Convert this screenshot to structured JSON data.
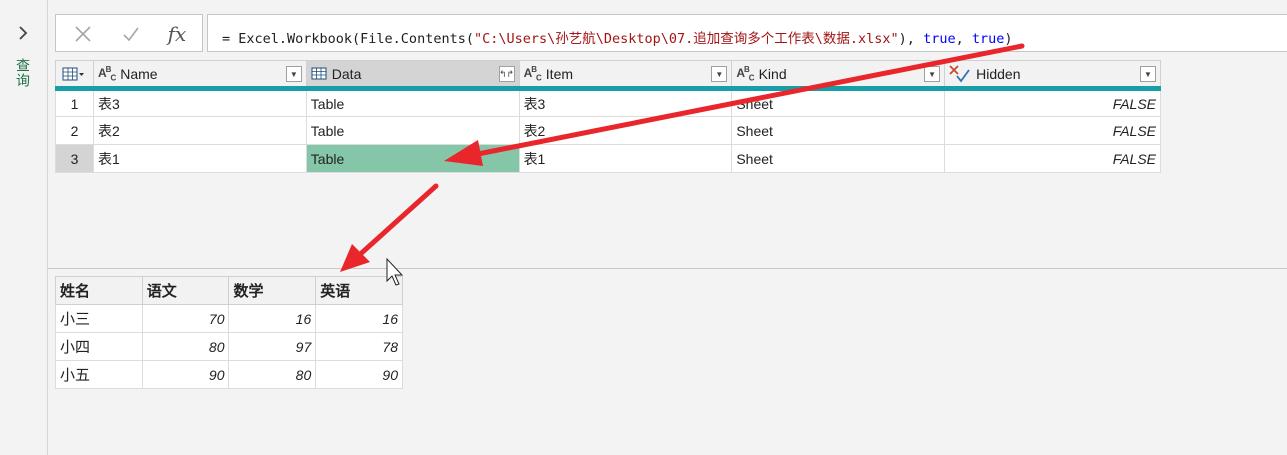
{
  "formula": {
    "prefix": "= Excel.Workbook(File.Contents(",
    "path": "\"C:\\Users\\孙艺航\\Desktop\\07.追加查询多个工作表\\数据.xlsx\"",
    "comma1": "), ",
    "arg1": "true",
    "comma2": ", ",
    "arg2": "true",
    "suffix": ")",
    "cancel_icon": "close-icon",
    "confirm_icon": "check-icon",
    "fx_label": "fx"
  },
  "queries_pane": {
    "label": "查询"
  },
  "main_table": {
    "columns": [
      {
        "type": "ABC",
        "label": "Name"
      },
      {
        "type": "table",
        "label": "Data"
      },
      {
        "type": "ABC",
        "label": "Item"
      },
      {
        "type": "ABC",
        "label": "Kind"
      },
      {
        "type": "logical",
        "label": "Hidden"
      }
    ],
    "rows": [
      {
        "num": "1",
        "name": "表3",
        "data": "Table",
        "item": "表3",
        "kind": "Sheet",
        "hidden": "FALSE"
      },
      {
        "num": "2",
        "name": "表2",
        "data": "Table",
        "item": "表2",
        "kind": "Sheet",
        "hidden": "FALSE"
      },
      {
        "num": "3",
        "name": "表1",
        "data": "Table",
        "item": "表1",
        "kind": "Sheet",
        "hidden": "FALSE"
      }
    ],
    "selected_row": 3,
    "selected_column": "Data"
  },
  "preview_table": {
    "columns": [
      "姓名",
      "语文",
      "数学",
      "英语"
    ],
    "rows": [
      [
        "小三",
        "70",
        "16",
        "16"
      ],
      [
        "小四",
        "80",
        "97",
        "78"
      ],
      [
        "小五",
        "90",
        "80",
        "90"
      ]
    ]
  },
  "colors": {
    "accent_teal": "#179ea8",
    "selected_cell": "#86c6a8",
    "arrow_red": "#e8262b",
    "queries_green": "#217346"
  }
}
